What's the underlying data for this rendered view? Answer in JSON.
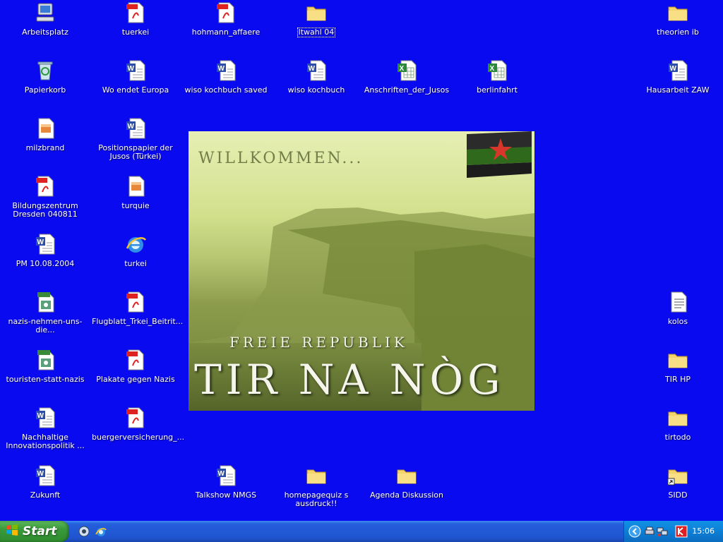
{
  "desktop": {
    "icons": [
      {
        "label": "Arbeitsplatz",
        "type": "computer"
      },
      {
        "label": "tuerkei",
        "type": "pdf"
      },
      {
        "label": "hohmann_affaere",
        "type": "pdf"
      },
      {
        "label": "ltwahl 04",
        "type": "folder"
      },
      {
        "label": "theorien ib",
        "type": "folder"
      },
      {
        "label": "Papierkorb",
        "type": "recycle"
      },
      {
        "label": "Wo endet Europa",
        "type": "word"
      },
      {
        "label": "wiso kochbuch saved",
        "type": "word"
      },
      {
        "label": "wiso kochbuch",
        "type": "word"
      },
      {
        "label": "Anschriften_der_Jusos",
        "type": "excel"
      },
      {
        "label": "berlinfahrt",
        "type": "excel"
      },
      {
        "label": "Hausarbeit ZAW",
        "type": "word"
      },
      {
        "label": "milzbrand",
        "type": "image"
      },
      {
        "label": "Positionspapier der Jusos (Türkei)",
        "type": "word"
      },
      {
        "label": "Bildungszentrum Dresden 040811",
        "type": "pdf"
      },
      {
        "label": "turquie",
        "type": "image"
      },
      {
        "label": "PM 10.08.2004",
        "type": "word"
      },
      {
        "label": "turkei",
        "type": "ie"
      },
      {
        "label": "nazis-nehmen-uns-die...",
        "type": "gif"
      },
      {
        "label": "Flugblatt_Trkei_Beitrit...",
        "type": "pdf"
      },
      {
        "label": "kolos",
        "type": "text"
      },
      {
        "label": "touristen-statt-nazis",
        "type": "gif"
      },
      {
        "label": "Plakate gegen Nazis",
        "type": "pdf"
      },
      {
        "label": "TIR HP",
        "type": "folder"
      },
      {
        "label": "Nachhaltige Innovationspolitik ...",
        "type": "word"
      },
      {
        "label": "buergerversicherung_...",
        "type": "pdf"
      },
      {
        "label": "tirtodo",
        "type": "folder"
      },
      {
        "label": "Zukunft",
        "type": "word"
      },
      {
        "label": "Talkshow NMGS",
        "type": "word"
      },
      {
        "label": "homepagequiz s ausdruck!!",
        "type": "folder"
      },
      {
        "label": "Agenda Diskussion",
        "type": "folder"
      },
      {
        "label": "SIDD",
        "type": "folder-shortcut"
      }
    ],
    "wallpaper": {
      "welcome": "WILLKOMMEN...",
      "republic": "FREIE REPUBLIK",
      "name": "TIR NA NÒG"
    }
  },
  "taskbar": {
    "start_label": "Start",
    "clock": "15:06"
  }
}
